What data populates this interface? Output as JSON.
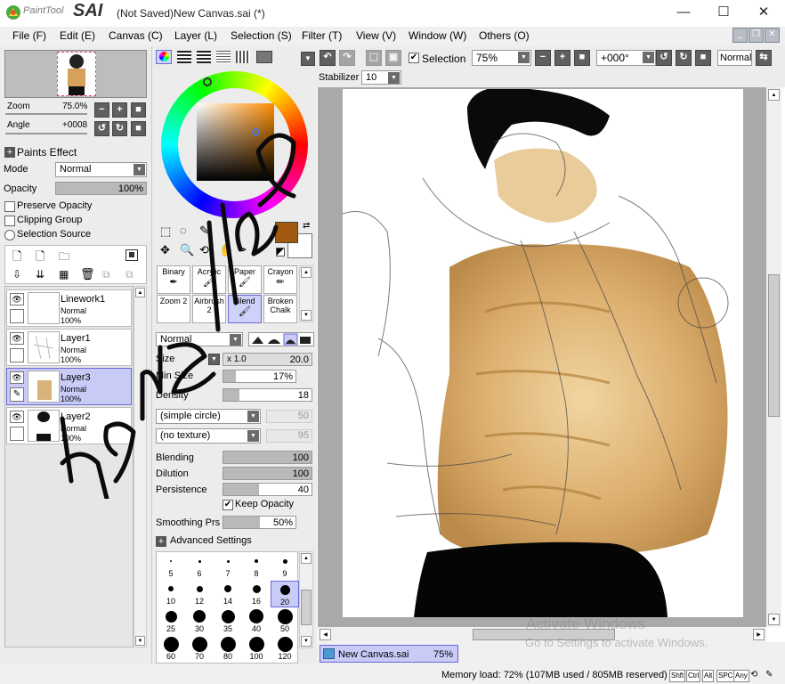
{
  "app": {
    "logo_text": "PaintTool",
    "logo_sai": "SAI",
    "window_title": "(Not Saved)New Canvas.sai (*)"
  },
  "window_controls": {
    "minimize": "—",
    "maximize": "☐",
    "close": "✕"
  },
  "menu": [
    "File (F)",
    "Edit (E)",
    "Canvas (C)",
    "Layer (L)",
    "Selection (S)",
    "Filter (T)",
    "View (V)",
    "Window (W)",
    "Others (O)"
  ],
  "navigator": {
    "zoom_label": "Zoom",
    "zoom_value": "75.0%",
    "angle_label": "Angle",
    "angle_value": "+0008"
  },
  "layer_props": {
    "paints_effect": "Paints Effect",
    "mode_label": "Mode",
    "mode_value": "Normal",
    "opacity_label": "Opacity",
    "opacity_value": "100%",
    "opacity_level": 1.0,
    "preserve_opacity": "Preserve Opacity",
    "clipping_group": "Clipping Group",
    "selection_source": "Selection Source"
  },
  "layers": [
    {
      "name": "Linework1",
      "mode": "Normal",
      "opacity": "100%",
      "selected": false
    },
    {
      "name": "Layer1",
      "mode": "Normal",
      "opacity": "100%",
      "selected": false
    },
    {
      "name": "Layer3",
      "mode": "Normal",
      "opacity": "100%",
      "selected": true
    },
    {
      "name": "Layer2",
      "mode": "Normal",
      "opacity": "100%",
      "selected": false
    }
  ],
  "tools": [
    {
      "name": "Binary",
      "selected": false
    },
    {
      "name": "Acrylic",
      "selected": false
    },
    {
      "name": "Paper",
      "selected": false
    },
    {
      "name": "Crayon",
      "selected": false
    },
    {
      "name": "Zoom 2",
      "selected": false
    },
    {
      "name": "Airbrush 2",
      "selected": false
    },
    {
      "name": "Blend",
      "selected": true
    },
    {
      "name": "Broken Chalk",
      "selected": false
    }
  ],
  "tool_settings": {
    "blend_mode": "Normal",
    "size_label": "Size",
    "size_multiplier": "x 1.0",
    "size_value": "20.0",
    "min_size_label": "Min Size",
    "min_size_value": "17%",
    "min_size_level": 0.17,
    "density_label": "Density",
    "density_value": "18",
    "density_level": 0.18,
    "shape": "(simple circle)",
    "shape_value": "50",
    "texture": "(no texture)",
    "texture_value": "95",
    "blending_label": "Blending",
    "blending_value": "100",
    "dilution_label": "Dilution",
    "dilution_value": "100",
    "persistence_label": "Persistence",
    "persistence_value": "40",
    "keep_opacity": "Keep Opacity",
    "smoothing_label": "Smoothing Prs",
    "smoothing_value": "50%",
    "advanced_settings": "Advanced Settings"
  },
  "brush_sizes": [
    "5",
    "6",
    "7",
    "8",
    "9",
    "10",
    "12",
    "14",
    "16",
    "20",
    "25",
    "30",
    "35",
    "40",
    "50",
    "60",
    "70",
    "80",
    "100",
    "120"
  ],
  "selected_brush_size": "20",
  "canvas_toolbar": {
    "selection_label": "Selection",
    "zoom_value": "75%",
    "angle_value": "+000°",
    "blend_mode": "Normal",
    "stabilizer_label": "Stabilizer",
    "stabilizer_value": "10"
  },
  "canvas_tab": {
    "name": "New Canvas.sai",
    "zoom": "75%"
  },
  "status": {
    "memory": "Memory load: 72% (107MB used / 805MB reserved)",
    "keys": [
      "Shft",
      "Ctrl",
      "Alt",
      "SPC",
      "Any"
    ]
  },
  "watermark": {
    "line1": "Activate Windows",
    "line2": "Go to Settings to activate Windows."
  },
  "colors": {
    "primary": "#a0590f",
    "secondary": "#ffffff",
    "selection": "#c9cbf7",
    "panel": "#ececec"
  }
}
